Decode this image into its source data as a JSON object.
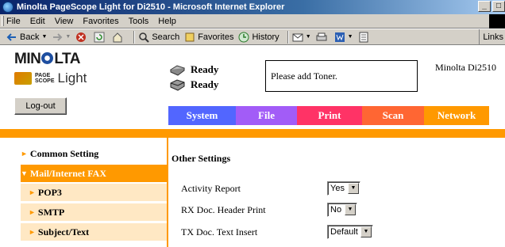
{
  "window": {
    "title": "Minolta PageScope Light for Di2510 - Microsoft Internet Explorer",
    "controls": [
      "_",
      "□"
    ]
  },
  "menubar": [
    "File",
    "Edit",
    "View",
    "Favorites",
    "Tools",
    "Help"
  ],
  "toolbar": {
    "back": "Back",
    "search": "Search",
    "favorites": "Favorites",
    "history": "History",
    "links": "Links"
  },
  "header": {
    "brand": "MIN",
    "brand_tail": "LTA",
    "page_scope_top": "PAGE",
    "page_scope_bottom": "SCOPE",
    "product": "Light",
    "status1": "Ready",
    "status2": "Ready",
    "message": "Please add Toner.",
    "model": "Minolta Di2510",
    "logout": "Log-out"
  },
  "tabs": [
    {
      "label": "System",
      "color": "#5266ff"
    },
    {
      "label": "File",
      "color": "#a25cf7"
    },
    {
      "label": "Print",
      "color": "#ff3366"
    },
    {
      "label": "Scan",
      "color": "#ff6633"
    },
    {
      "label": "Network",
      "color": "#ff9900"
    }
  ],
  "accent": "#ff9900",
  "sidebar": {
    "items": [
      {
        "label": "Common Setting"
      },
      {
        "label": "Mail/Internet FAX",
        "active": true
      },
      {
        "label": "POP3"
      },
      {
        "label": "SMTP"
      },
      {
        "label": "Subject/Text"
      }
    ]
  },
  "main": {
    "heading": "Other Settings",
    "settings": [
      {
        "label": "Activity Report",
        "value": "Yes"
      },
      {
        "label": "RX Doc. Header Print",
        "value": "No"
      },
      {
        "label": "TX Doc. Text Insert",
        "value": "Default"
      }
    ]
  }
}
